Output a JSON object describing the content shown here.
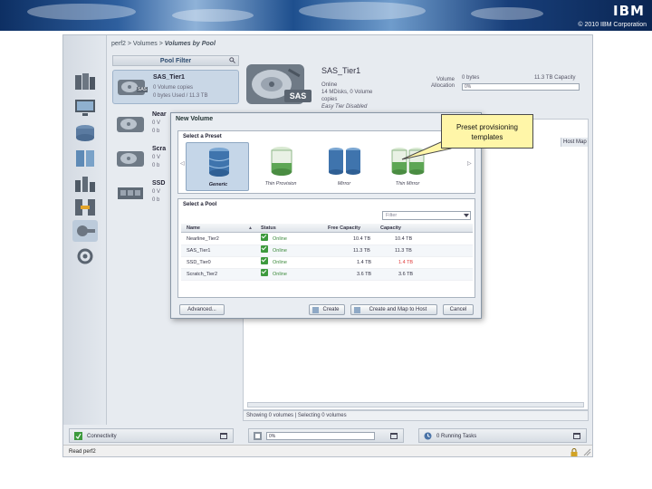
{
  "header": {
    "copyright": "© 2010 IBM Corporation",
    "logo": "IBM"
  },
  "breadcrumb": {
    "path": "perf2 > Volumes > ",
    "current": "Volumes by Pool"
  },
  "pool_filter": {
    "title": "Pool Filter",
    "items": [
      {
        "name": "SAS_Tier1",
        "line1": "0 Volume copies",
        "line2": "0 bytes Used / 11.3 TB",
        "selected": true,
        "badge": "SAS"
      },
      {
        "name": "Near",
        "line1": "0 V",
        "line2": "0 b",
        "selected": false,
        "badge": ""
      },
      {
        "name": "Scra",
        "line1": "0 V",
        "line2": "0 b",
        "selected": false,
        "badge": ""
      },
      {
        "name": "SSD",
        "line1": "0 V",
        "line2": "0 b",
        "selected": false,
        "badge": ""
      }
    ]
  },
  "detail": {
    "title": "SAS_Tier1",
    "badge": "SAS",
    "status": "Online",
    "mdisks": "14 MDisks, 0 Volume",
    "copies": "copies",
    "easy_tier": "Easy Tier Disabled",
    "allocation_label": "Volume Allocation",
    "used": "0 bytes",
    "capacity": "11.3 TB Capacity",
    "percent": "0%"
  },
  "volume_table": {
    "last_column": "Host Map",
    "status_text": "Showing 0 volumes | Selecting 0 volumes"
  },
  "bottom": {
    "connectivity": "Connectivity",
    "progress": "0%",
    "tasks": "0 Running Tasks",
    "browser_status": "Read perf2"
  },
  "modal": {
    "title": "New Volume",
    "preset_section": "Select a Preset",
    "presets": [
      {
        "label": "Generic",
        "selected": true
      },
      {
        "label": "Thin Provision",
        "selected": false
      },
      {
        "label": "Mirror",
        "selected": false
      },
      {
        "label": "Thin Mirror",
        "selected": false
      }
    ],
    "pool_section": "Select a Pool",
    "filter_placeholder": "Filter",
    "columns": [
      "Name",
      "Status",
      "Free Capacity",
      "Capacity"
    ],
    "rows": [
      {
        "name": "Nearline_Tier2",
        "status": "Online",
        "free": "10.4 TB",
        "capacity": "10.4 TB",
        "highlight": false
      },
      {
        "name": "SAS_Tier1",
        "status": "Online",
        "free": "11.3 TB",
        "capacity": "11.3 TB",
        "highlight": false
      },
      {
        "name": "SSD_Tier0",
        "status": "Online",
        "free": "1.4 TB",
        "capacity": "1.4 TB",
        "highlight": true
      },
      {
        "name": "Scratch_Tier2",
        "status": "Online",
        "free": "3.6 TB",
        "capacity": "3.6 TB",
        "highlight": false
      }
    ],
    "buttons": {
      "advanced": "Advanced...",
      "create": "Create",
      "create_map": "Create and Map to Host",
      "cancel": "Cancel"
    }
  },
  "callout": {
    "text": "Preset provisioning templates"
  },
  "colors": {
    "accent": "#1e4f8e",
    "selection": "#c5d6e8",
    "online": "#3c8a3c",
    "callout": "#fff6a8"
  }
}
